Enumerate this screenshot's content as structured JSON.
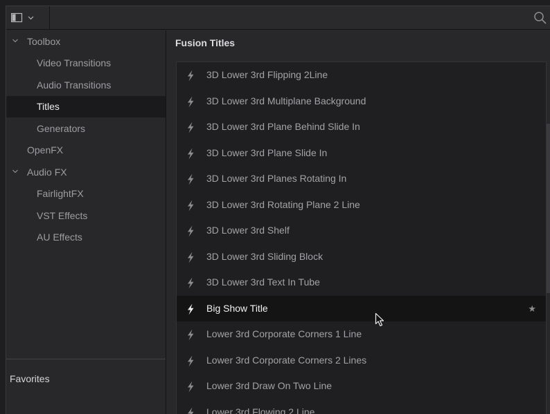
{
  "toolbar": {
    "panel_toggle_icon": "panel-layout-icon",
    "dropdown_icon": "chevron-down-icon",
    "search_icon": "search-icon"
  },
  "sidebar": {
    "items": [
      {
        "label": "Toolbox",
        "level": 0,
        "expanded": true
      },
      {
        "label": "Video Transitions",
        "level": 1
      },
      {
        "label": "Audio Transitions",
        "level": 1
      },
      {
        "label": "Titles",
        "level": 1,
        "selected": true
      },
      {
        "label": "Generators",
        "level": 1
      },
      {
        "label": "OpenFX",
        "level": 0
      },
      {
        "label": "Audio FX",
        "level": 0,
        "expanded": true
      },
      {
        "label": "FairlightFX",
        "level": 1
      },
      {
        "label": "VST Effects",
        "level": 1
      },
      {
        "label": "AU Effects",
        "level": 1
      }
    ],
    "favorites_label": "Favorites"
  },
  "main": {
    "title": "Fusion Titles",
    "items": [
      {
        "label": "3D Lower 3rd Flipping 2Line"
      },
      {
        "label": "3D Lower 3rd Multiplane Background"
      },
      {
        "label": "3D Lower 3rd Plane Behind Slide In"
      },
      {
        "label": "3D Lower 3rd Plane Slide In"
      },
      {
        "label": "3D Lower 3rd Planes Rotating In"
      },
      {
        "label": "3D Lower 3rd Rotating Plane 2 Line"
      },
      {
        "label": "3D Lower 3rd Shelf"
      },
      {
        "label": "3D Lower 3rd Sliding Block"
      },
      {
        "label": "3D Lower 3rd Text In Tube"
      },
      {
        "label": "Big Show Title",
        "highlighted": true,
        "favorite_star": "★"
      },
      {
        "label": "Lower 3rd Corporate Corners 1 Line"
      },
      {
        "label": "Lower 3rd Corporate Corners 2 Lines"
      },
      {
        "label": "Lower 3rd Draw On Two Line"
      },
      {
        "label": "Lower 3rd Flowing 2 Line"
      }
    ]
  },
  "colors": {
    "panel_bg": "#28282b",
    "list_bg": "#1f1f21",
    "selected_bg": "#141415",
    "text": "#a3a3a6",
    "text_active": "#f2f2f3"
  }
}
